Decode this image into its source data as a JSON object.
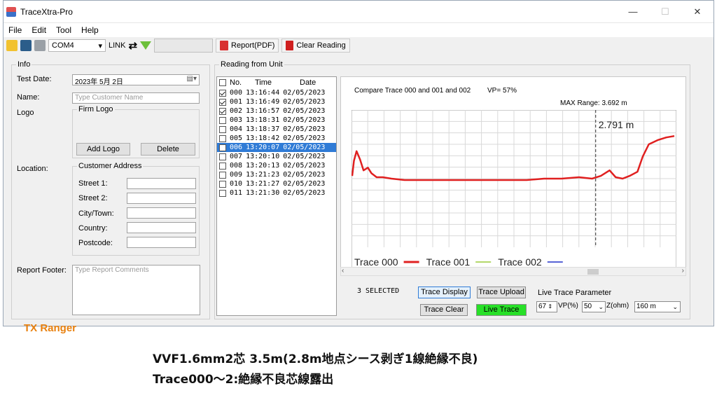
{
  "window": {
    "title": "TraceXtra-Pro",
    "minimize": "—",
    "maximize": "☐",
    "close": "✕"
  },
  "menu": [
    "File",
    "Edit",
    "Tool",
    "Help"
  ],
  "toolbar": {
    "port": "COM4",
    "link_label": "LINK",
    "link_icon": "⇄",
    "report_label": "Report(PDF)",
    "clear_label": "Clear Reading"
  },
  "info": {
    "legend": "Info",
    "test_date_label": "Test Date:",
    "test_date_value": "2023年 5月 2日",
    "name_label": "Name:",
    "name_placeholder": "Type Customer Name",
    "logo_label": "Logo",
    "firm_logo_legend": "Firm Logo",
    "add_logo": "Add Logo",
    "delete": "Delete",
    "location_label": "Location:",
    "address_legend": "Customer Address",
    "street1": "Street 1:",
    "street2": "Street 2:",
    "city": "City/Town:",
    "country": "Country:",
    "postcode": "Postcode:",
    "report_footer_label": "Report Footer:",
    "report_footer_placeholder": "Type Report Comments"
  },
  "reading": {
    "legend": "Reading from Unit",
    "headers": {
      "no": "No.",
      "time": "Time",
      "date": "Date"
    },
    "rows": [
      {
        "no": "000",
        "time": "13:16:44",
        "date": "02/05/2023",
        "checked": true,
        "selected": false
      },
      {
        "no": "001",
        "time": "13:16:49",
        "date": "02/05/2023",
        "checked": true,
        "selected": false
      },
      {
        "no": "002",
        "time": "13:16:57",
        "date": "02/05/2023",
        "checked": true,
        "selected": false
      },
      {
        "no": "003",
        "time": "13:18:31",
        "date": "02/05/2023",
        "checked": false,
        "selected": false
      },
      {
        "no": "004",
        "time": "13:18:37",
        "date": "02/05/2023",
        "checked": false,
        "selected": false
      },
      {
        "no": "005",
        "time": "13:18:42",
        "date": "02/05/2023",
        "checked": false,
        "selected": false
      },
      {
        "no": "006",
        "time": "13:20:07",
        "date": "02/05/2023",
        "checked": false,
        "selected": true
      },
      {
        "no": "007",
        "time": "13:20:10",
        "date": "02/05/2023",
        "checked": false,
        "selected": false
      },
      {
        "no": "008",
        "time": "13:20:13",
        "date": "02/05/2023",
        "checked": false,
        "selected": false
      },
      {
        "no": "009",
        "time": "13:21:23",
        "date": "02/05/2023",
        "checked": false,
        "selected": false
      },
      {
        "no": "010",
        "time": "13:21:27",
        "date": "02/05/2023",
        "checked": false,
        "selected": false
      },
      {
        "no": "011",
        "time": "13:21:30",
        "date": "02/05/2023",
        "checked": false,
        "selected": false
      }
    ]
  },
  "chart_header": {
    "compare": "Compare Trace 000 and 001 and 002",
    "vp": "VP= 57%",
    "max_range": "MAX Range: 3.692 m",
    "cursor_label": "2.791 m"
  },
  "chart_data": {
    "type": "line",
    "x_unit": "m",
    "xlim": [
      0,
      3.692
    ],
    "cursor_x": 2.791,
    "series": [
      {
        "name": "Trace 000",
        "color": "#e02020",
        "points": [
          [
            0.0,
            0.52
          ],
          [
            0.02,
            0.63
          ],
          [
            0.05,
            0.7
          ],
          [
            0.09,
            0.64
          ],
          [
            0.13,
            0.56
          ],
          [
            0.18,
            0.58
          ],
          [
            0.22,
            0.54
          ],
          [
            0.28,
            0.51
          ],
          [
            0.35,
            0.51
          ],
          [
            0.45,
            0.5
          ],
          [
            0.6,
            0.49
          ],
          [
            0.8,
            0.49
          ],
          [
            1.0,
            0.49
          ],
          [
            1.2,
            0.49
          ],
          [
            1.4,
            0.49
          ],
          [
            1.6,
            0.49
          ],
          [
            1.8,
            0.49
          ],
          [
            2.0,
            0.49
          ],
          [
            2.2,
            0.5
          ],
          [
            2.4,
            0.5
          ],
          [
            2.6,
            0.51
          ],
          [
            2.75,
            0.5
          ],
          [
            2.85,
            0.52
          ],
          [
            2.95,
            0.56
          ],
          [
            3.02,
            0.51
          ],
          [
            3.1,
            0.5
          ],
          [
            3.18,
            0.52
          ],
          [
            3.27,
            0.55
          ],
          [
            3.33,
            0.66
          ],
          [
            3.4,
            0.75
          ],
          [
            3.5,
            0.78
          ],
          [
            3.6,
            0.8
          ],
          [
            3.692,
            0.81
          ]
        ]
      },
      {
        "name": "Trace 001",
        "color": "#9ccc3a",
        "points": [
          [
            0.0,
            0.52
          ],
          [
            0.02,
            0.63
          ],
          [
            0.05,
            0.7
          ],
          [
            0.09,
            0.64
          ],
          [
            0.13,
            0.56
          ],
          [
            0.18,
            0.58
          ],
          [
            0.22,
            0.54
          ],
          [
            0.28,
            0.51
          ],
          [
            0.35,
            0.51
          ],
          [
            0.45,
            0.5
          ],
          [
            0.6,
            0.49
          ],
          [
            0.8,
            0.49
          ],
          [
            1.0,
            0.49
          ],
          [
            1.2,
            0.49
          ],
          [
            1.4,
            0.49
          ],
          [
            1.6,
            0.49
          ],
          [
            1.8,
            0.49
          ],
          [
            2.0,
            0.49
          ],
          [
            2.2,
            0.5
          ],
          [
            2.4,
            0.5
          ],
          [
            2.6,
            0.51
          ],
          [
            2.75,
            0.5
          ],
          [
            2.85,
            0.52
          ],
          [
            2.95,
            0.56
          ],
          [
            3.02,
            0.51
          ],
          [
            3.1,
            0.5
          ],
          [
            3.18,
            0.52
          ],
          [
            3.27,
            0.55
          ],
          [
            3.33,
            0.66
          ],
          [
            3.4,
            0.75
          ],
          [
            3.5,
            0.78
          ],
          [
            3.6,
            0.8
          ],
          [
            3.692,
            0.81
          ]
        ]
      },
      {
        "name": "Trace 002",
        "color": "#2030c8",
        "points": [
          [
            0.0,
            0.52
          ],
          [
            0.02,
            0.63
          ],
          [
            0.05,
            0.7
          ],
          [
            0.09,
            0.64
          ],
          [
            0.13,
            0.56
          ],
          [
            0.18,
            0.58
          ],
          [
            0.22,
            0.54
          ],
          [
            0.28,
            0.51
          ],
          [
            0.35,
            0.51
          ],
          [
            0.45,
            0.5
          ],
          [
            0.6,
            0.49
          ],
          [
            0.8,
            0.49
          ],
          [
            1.0,
            0.49
          ],
          [
            1.2,
            0.49
          ],
          [
            1.4,
            0.49
          ],
          [
            1.6,
            0.49
          ],
          [
            1.8,
            0.49
          ],
          [
            2.0,
            0.49
          ],
          [
            2.2,
            0.5
          ],
          [
            2.4,
            0.5
          ],
          [
            2.6,
            0.51
          ],
          [
            2.75,
            0.5
          ],
          [
            2.85,
            0.52
          ],
          [
            2.95,
            0.56
          ],
          [
            3.02,
            0.51
          ],
          [
            3.1,
            0.5
          ],
          [
            3.18,
            0.52
          ],
          [
            3.27,
            0.55
          ],
          [
            3.33,
            0.66
          ],
          [
            3.4,
            0.75
          ],
          [
            3.5,
            0.78
          ],
          [
            3.6,
            0.8
          ],
          [
            3.692,
            0.81
          ]
        ]
      }
    ],
    "grid": true,
    "legend_position": "bottom-left"
  },
  "controls": {
    "selected_count": "3 SELECTED",
    "trace_display": "Trace Display",
    "trace_upload": "Trace Upload",
    "trace_clear": "Trace Clear",
    "live_trace": "Live Trace",
    "live_param_label": "Live Trace Parameter",
    "vp_value": "67",
    "vp_label": "VP(%)",
    "z_value": "50",
    "z_label": "Z(ohm)",
    "range_value": "160 m"
  },
  "brand": "TX Ranger",
  "caption": {
    "line1": "VVF1.6mm2芯  3.5m(2.8m地点シース剥ぎ1線絶縁不良)",
    "line2": "Trace000～2:絶縁不良芯線露出"
  }
}
